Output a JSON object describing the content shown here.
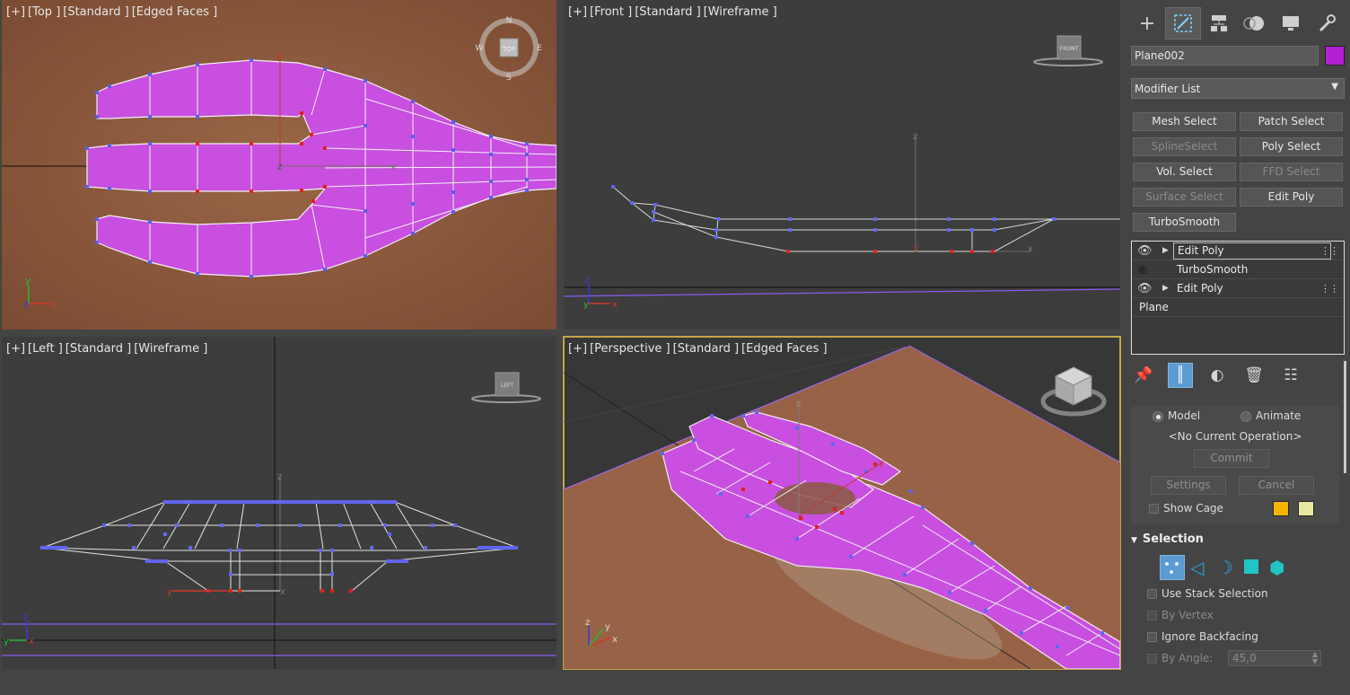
{
  "viewports": {
    "top": {
      "labels": [
        "[+]",
        "[Top ]",
        "[Standard ]",
        "[Edged Faces ]"
      ],
      "compass": {
        "n": "N",
        "s": "S",
        "e": "E",
        "w": "W",
        "cube": "TOP"
      }
    },
    "front": {
      "labels": [
        "[+]",
        "[Front ]",
        "[Standard ]",
        "[Wireframe ]"
      ],
      "cube": "FRONT"
    },
    "left": {
      "labels": [
        "[+]",
        "[Left ]",
        "[Standard ]",
        "[Wireframe ]"
      ],
      "cube": "LEFT"
    },
    "perspective": {
      "labels": [
        "[+]",
        "[Perspective ]",
        "[Standard ]",
        "[Edged Faces ]"
      ]
    }
  },
  "axes": {
    "x": "x",
    "y": "y",
    "z": "z"
  },
  "panel": {
    "tabs": [
      {
        "name": "create",
        "icon": "plus-icon"
      },
      {
        "name": "modify",
        "icon": "modify-icon",
        "active": true
      },
      {
        "name": "hierarchy",
        "icon": "hierarchy-icon"
      },
      {
        "name": "motion",
        "icon": "motion-icon"
      },
      {
        "name": "display",
        "icon": "display-icon"
      },
      {
        "name": "utilities",
        "icon": "wrench-icon"
      }
    ],
    "object_name": "Plane002",
    "object_color": "#b41fd6",
    "modifier_list": "Modifier List",
    "modifier_buttons": {
      "mesh_select": "Mesh Select",
      "patch_select": "Patch Select",
      "spline_select": "SplineSelect",
      "poly_select": "Poly Select",
      "vol_select": "Vol. Select",
      "ffd_select": "FFD Select",
      "surface_select": "Surface Select",
      "edit_poly": "Edit Poly",
      "turbosmooth": "TurboSmooth"
    },
    "stack": [
      "Edit Poly",
      "TurboSmooth",
      "Edit Poly",
      "Plane"
    ],
    "edit_poly": {
      "model": "Model",
      "animate": "Animate",
      "current_op": "<No Current Operation>",
      "commit": "Commit",
      "settings": "Settings",
      "cancel": "Cancel",
      "show_cage": "Show Cage",
      "cage_color_1": "#f6b400",
      "cage_color_2": "#e8e7a0"
    },
    "selection": {
      "title": "Selection",
      "use_stack": "Use Stack Selection",
      "by_vertex": "By Vertex",
      "ignore_backfacing": "Ignore Backfacing",
      "by_angle": "By Angle:",
      "angle_value": "45,0"
    }
  }
}
